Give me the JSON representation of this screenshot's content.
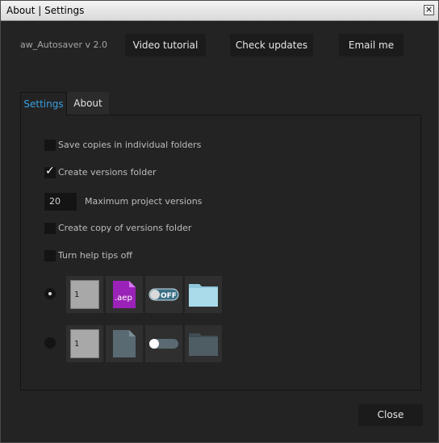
{
  "window": {
    "title": "About | Settings",
    "close_glyph": "×"
  },
  "header": {
    "version": "aw_Autosaver v 2.0",
    "buttons": {
      "video": "Video tutorial",
      "updates": "Check updates",
      "email": "Email me"
    }
  },
  "tabs": {
    "settings": "Settings",
    "about": "About",
    "active": "Settings"
  },
  "settings": {
    "options": [
      {
        "label": "Save copies in individual folders",
        "checked": false
      },
      {
        "label": "Create versions folder",
        "checked": true
      },
      {
        "label": "Create copy of versions folder",
        "checked": false
      },
      {
        "label": "Turn help tips off",
        "checked": false
      }
    ],
    "max_versions": {
      "value": "20",
      "label": "Maximum project versions"
    },
    "themes": [
      {
        "selected": true,
        "number": "1",
        "file_label": ".aep",
        "toggle_label": "OFF",
        "number_bg": "#a8a8a8",
        "file_color": "#9b22b8",
        "folder_color": "#a9dbea"
      },
      {
        "selected": false,
        "number": "1",
        "file_label": "",
        "toggle_label": "",
        "number_bg": "#a8a8a8",
        "file_color": "#5a6a72",
        "folder_color": "#4e5d64"
      }
    ],
    "icons": [
      "number-box-icon",
      "aep-file-icon",
      "toggle-switch-icon",
      "folder-icon"
    ]
  },
  "footer": {
    "close": "Close"
  },
  "colors": {
    "accent": "#3aa0e0",
    "background": "#232323",
    "button_bg": "#1b1b1b"
  }
}
